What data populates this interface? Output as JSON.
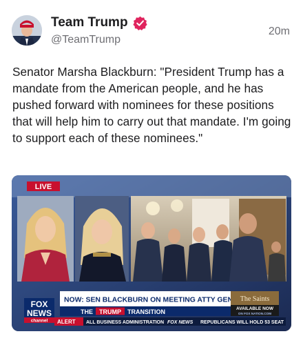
{
  "account": {
    "name": "Team Trump",
    "handle": "@TeamTrump",
    "timestamp": "20m",
    "verified_color": "#e0245e"
  },
  "post": {
    "text": "Senator Marsha Blackburn: \"President Trump has a mandate from the American people, and he has pushed forward with nominees for these positions that will help him to carry out that mandate. I'm going to support each of these nominees.\""
  },
  "video": {
    "live_badge": "LIVE",
    "logo_line1": "FOX",
    "logo_line2": "NEWS",
    "logo_line3": "channel",
    "headline": "NOW: SEN BLACKBURN ON MEETING ATTY GEN PICK GAETZ",
    "transition_pre": "THE",
    "transition_highlight": "TRUMP",
    "transition_post": "TRANSITION",
    "promo_title": "The Saints",
    "promo_sub": "AVAILABLE NOW",
    "promo_sub2": "ON FOX NATION.COM",
    "ticker_alert": "ALERT",
    "ticker_text": "ALL BUSINESS ADMINISTRATION",
    "ticker_text2": "FOX NEWS",
    "ticker_text3": "REPUBLICANS WILL HOLD 53 SEAT",
    "colors": {
      "fox_blue": "#0b2a6b",
      "fox_red": "#c8102e",
      "headline_bg": "#ffffff",
      "ticker_bg": "#0d1b3d"
    }
  }
}
